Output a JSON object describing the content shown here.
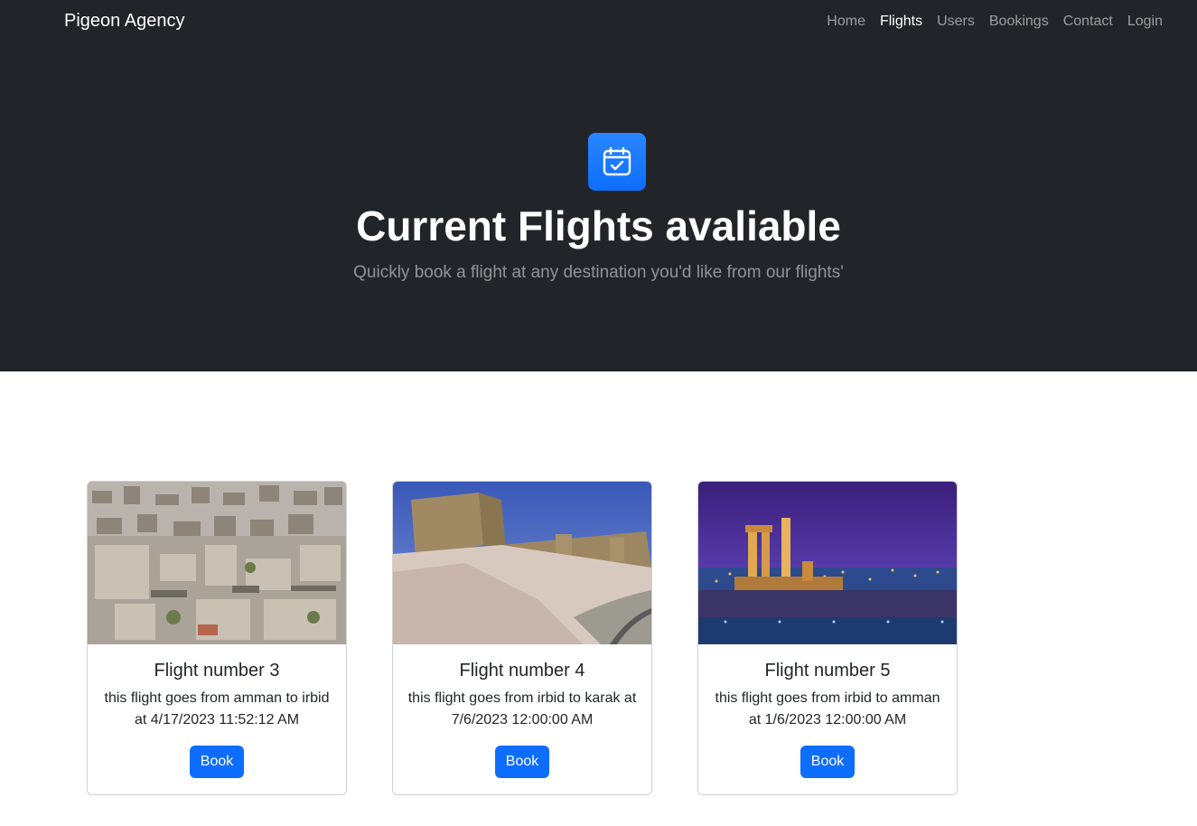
{
  "navbar": {
    "brand": "Pigeon Agency",
    "links": [
      "Home",
      "Flights",
      "Users",
      "Bookings",
      "Contact",
      "Login"
    ],
    "active": "Flights"
  },
  "hero": {
    "icon": "calendar-check-icon",
    "title": "Current Flights avaliable",
    "subtitle": "Quickly book a flight at any destination you'd like from our flights'"
  },
  "cards": [
    {
      "image": "amman-city-aerial-photo",
      "title": "Flight number 3",
      "text": "this flight goes from amman to irbid at 4/17/2023 11:52:12 AM",
      "button": "Book"
    },
    {
      "image": "karak-castle-photo",
      "title": "Flight number 4",
      "text": "this flight goes from irbid to karak at 7/6/2023 12:00:00 AM",
      "button": "Book"
    },
    {
      "image": "amman-citadel-night-photo",
      "title": "Flight number 5",
      "text": "this flight goes from irbid to amman at 1/6/2023 12:00:00 AM",
      "button": "Book"
    }
  ],
  "colors": {
    "hero_bg": "#212529",
    "primary": "#0d6efd"
  }
}
